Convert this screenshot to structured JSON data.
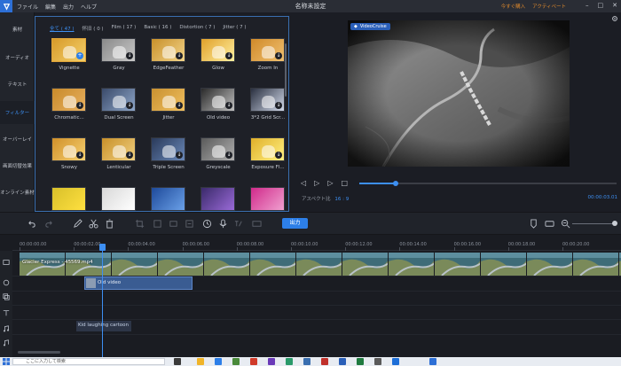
{
  "app": {
    "doc_title": "名称未設定",
    "menu": [
      "ファイル",
      "編集",
      "出力",
      "ヘルプ"
    ],
    "right_links": [
      "今すぐ購入",
      "アクティベート"
    ]
  },
  "leftnav": {
    "items": [
      "素材",
      "オーディオ",
      "テキスト",
      "フィルター",
      "オーバーレイ",
      "画面切替効果",
      "オンライン素材"
    ],
    "active": "フィルター"
  },
  "filters": {
    "tabs": [
      "全て ( 47 )",
      "怀旧 ( 0 )",
      "Film ( 17 )",
      "Basic ( 16 )",
      "Distortion ( 7 )",
      "Jitter ( 7 )"
    ],
    "active_tab": "全て ( 47 )",
    "items": [
      {
        "label": "Vignette",
        "selected": true,
        "badge": "+"
      },
      {
        "label": "Gray"
      },
      {
        "label": "EdgeFeather"
      },
      {
        "label": "Glow"
      },
      {
        "label": "Zoom In"
      },
      {
        "label": "Chromatic..."
      },
      {
        "label": "Dual Screen"
      },
      {
        "label": "Jitter"
      },
      {
        "label": "Old video"
      },
      {
        "label": "3*2 Grid Scr..."
      },
      {
        "label": "Snowy"
      },
      {
        "label": "Lenticular"
      },
      {
        "label": "Triple Screen"
      },
      {
        "label": "Greyscale"
      },
      {
        "label": "Exposure Fl..."
      },
      {
        "label": ""
      },
      {
        "label": ""
      },
      {
        "label": ""
      },
      {
        "label": ""
      },
      {
        "label": ""
      }
    ]
  },
  "preview": {
    "watermark": "VideoCruise",
    "aspect_label": "アスペクト比",
    "aspect_value": "16 : 9",
    "time": "00:00:03.01",
    "progress": 0.14
  },
  "toolbar": {
    "export_label": "出力"
  },
  "timeline": {
    "ticks": [
      "00:00:00.00",
      "00:00:02.00",
      "00:00:04.00",
      "00:00:06.00",
      "00:00:08.00",
      "00:00:10.00",
      "00:00:12.00",
      "00:00:14.00",
      "00:00:16.00",
      "00:00:18.00",
      "00:00:20.00"
    ],
    "video_clip_label": "Glacier Express - 45569.mp4",
    "filter_clip_label": "Old video",
    "text_clip_label": "Kid laughing cartoon"
  },
  "taskbar": {
    "search_placeholder": "ここに入力して検索"
  },
  "colors": {
    "accent": "#3d8ff2",
    "panel_border": "#3a6fb0",
    "export_button": "#2d7fe8"
  }
}
